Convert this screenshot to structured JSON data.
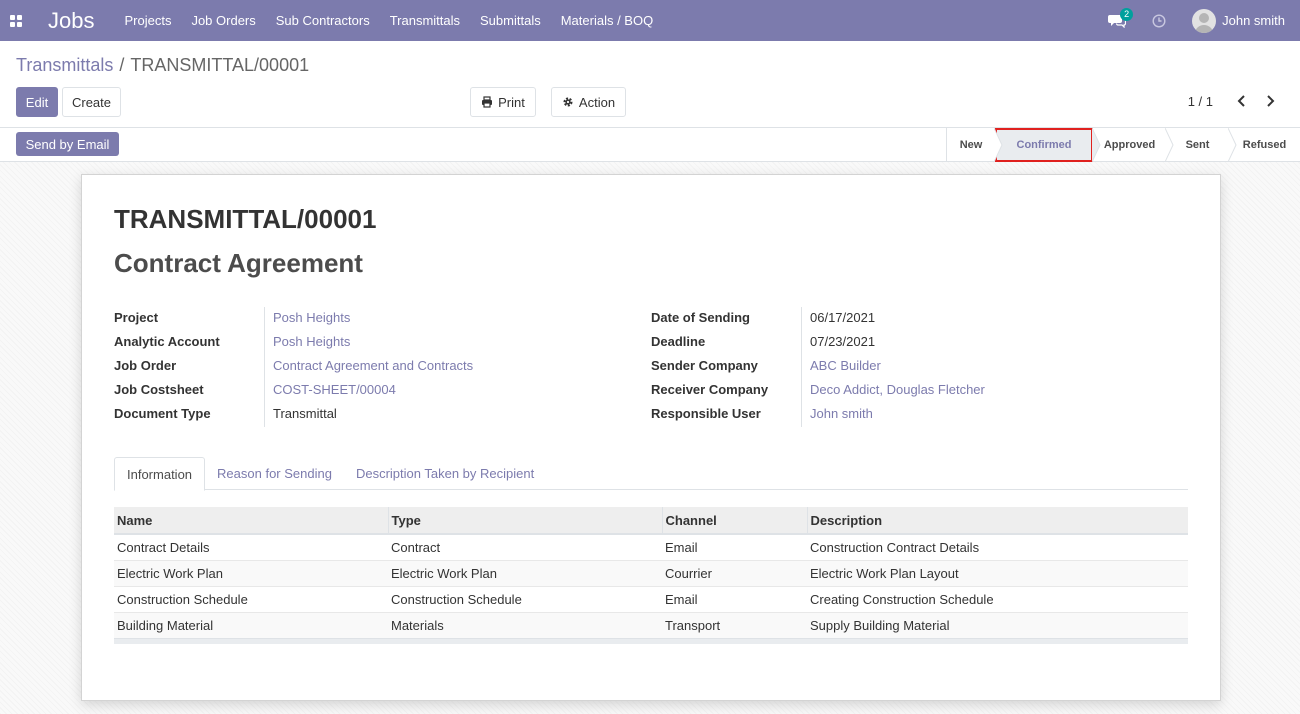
{
  "navbar": {
    "brand": "Jobs",
    "menu": [
      "Projects",
      "Job Orders",
      "Sub Contractors",
      "Transmittals",
      "Submittals",
      "Materials / BOQ"
    ],
    "chat_count": "2",
    "user_name": "John smith",
    "color": "#7c7bad"
  },
  "breadcrumb": {
    "parent": "Transmittals",
    "separator": "/",
    "current": "TRANSMITTAL/00001"
  },
  "toolbar": {
    "edit_label": "Edit",
    "create_label": "Create",
    "print_label": "Print",
    "action_label": "Action"
  },
  "pager": {
    "value": "1 / 1"
  },
  "statusbar": {
    "send_email_label": "Send by Email",
    "stages": [
      "New",
      "Confirmed",
      "Approved",
      "Sent",
      "Refused"
    ],
    "active_stage": "Confirmed"
  },
  "record": {
    "number": "TRANSMITTAL/00001",
    "title": "Contract Agreement",
    "left_fields": [
      {
        "label": "Project",
        "value": "Posh Heights"
      },
      {
        "label": "Analytic Account",
        "value": "Posh Heights"
      },
      {
        "label": "Job Order",
        "value": "Contract Agreement and Contracts"
      },
      {
        "label": "Job Costsheet",
        "value": "COST-SHEET/00004"
      },
      {
        "label": "Document Type",
        "value": "Transmittal"
      }
    ],
    "right_fields": [
      {
        "label": "Date of Sending",
        "value": "06/17/2021"
      },
      {
        "label": "Deadline",
        "value": "07/23/2021"
      },
      {
        "label": "Sender Company",
        "value": "ABC Builder"
      },
      {
        "label": "Receiver Company",
        "value": "Deco Addict, Douglas Fletcher"
      },
      {
        "label": "Responsible User",
        "value": "John smith"
      }
    ]
  },
  "tabs": [
    "Information",
    "Reason for Sending",
    "Description Taken by Recipient"
  ],
  "table": {
    "headers": [
      "Name",
      "Type",
      "Channel",
      "Description"
    ],
    "rows": [
      [
        "Contract Details",
        "Contract",
        "Email",
        "Construction Contract Details"
      ],
      [
        "Electric Work Plan",
        "Electric Work Plan",
        "Courrier",
        "Electric Work Plan Layout"
      ],
      [
        "Construction Schedule",
        "Construction Schedule",
        "Email",
        "Creating Construction Schedule"
      ],
      [
        "Building Material",
        "Materials",
        "Transport",
        "Supply Building Material"
      ]
    ]
  }
}
